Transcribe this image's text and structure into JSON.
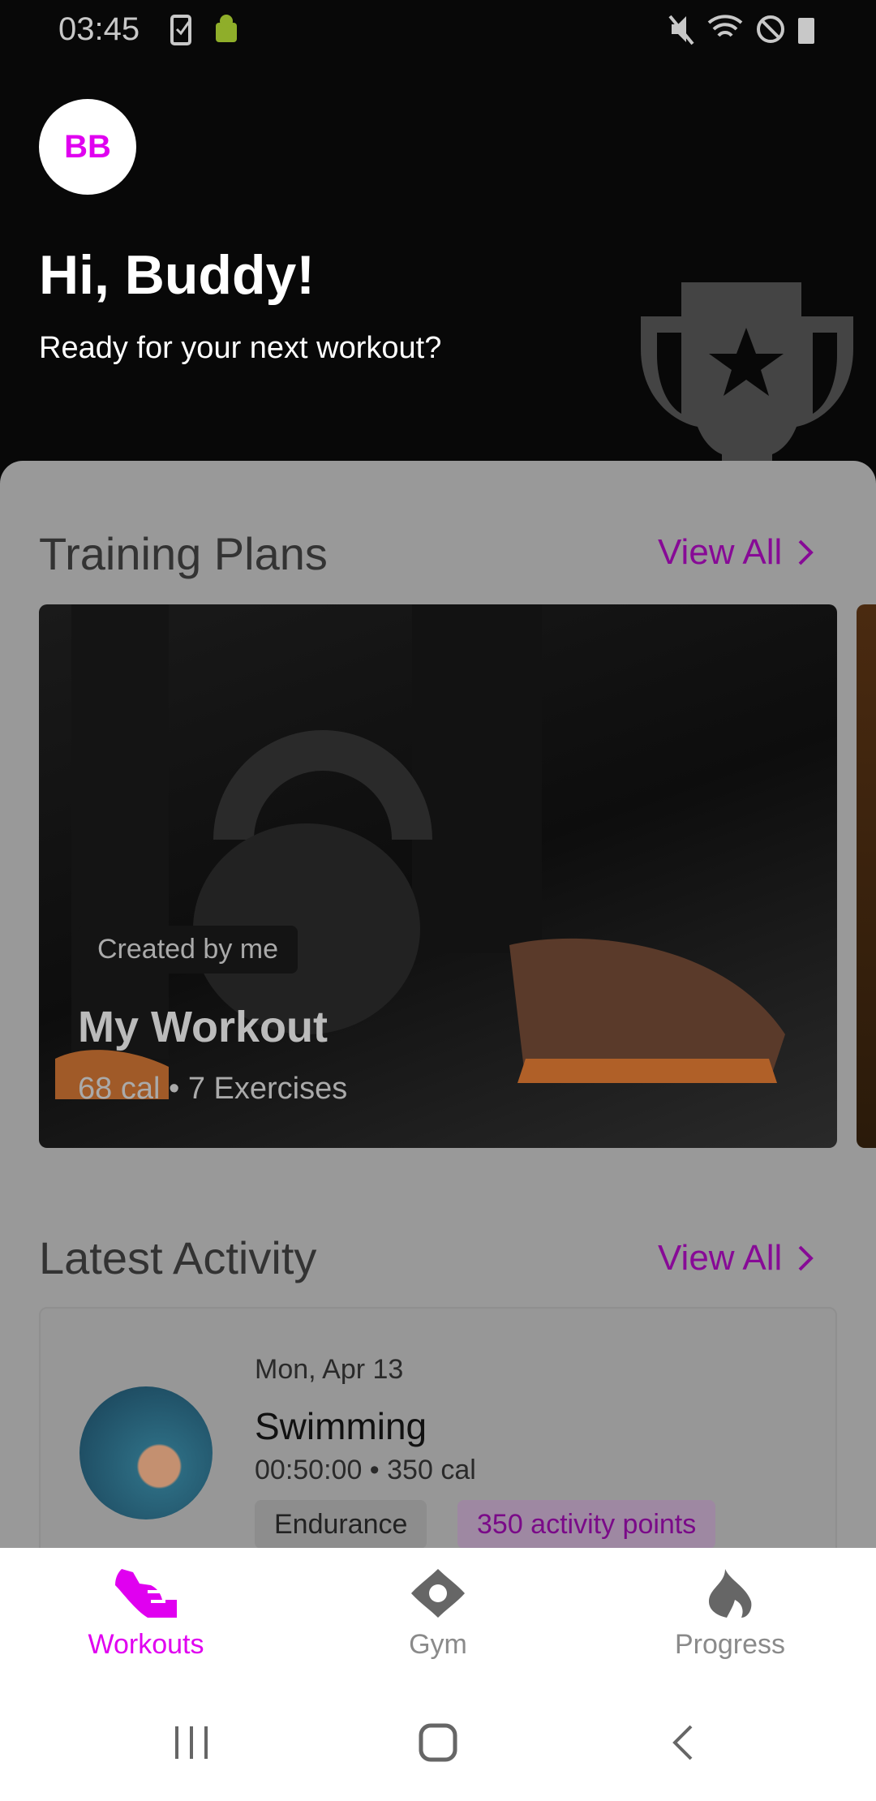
{
  "status_bar": {
    "time": "03:45",
    "icons": [
      "task-check-icon",
      "android-debug-icon",
      "mute-icon",
      "wifi-icon",
      "do-not-disturb-icon",
      "battery-icon"
    ]
  },
  "header": {
    "avatar_initials": "BB",
    "greeting": "Hi, Buddy!",
    "subtitle": "Ready for your next workout?",
    "decor_icon": "trophy-icon"
  },
  "training_plans": {
    "title": "Training Plans",
    "view_all": "View All",
    "cards": [
      {
        "badge": "Created by me",
        "title": "My Workout",
        "subtitle": "68 cal • 7 Exercises"
      }
    ]
  },
  "latest_activity": {
    "title": "Latest Activity",
    "view_all": "View All",
    "items": [
      {
        "date": "Mon, Apr 13",
        "title": "Swimming",
        "details": "00:50:00 • 350 cal",
        "tags": [
          "Endurance",
          "350 activity points"
        ]
      }
    ]
  },
  "bottom_nav": {
    "items": [
      {
        "label": "Workouts",
        "icon": "shoe-icon",
        "active": true
      },
      {
        "label": "Gym",
        "icon": "location-icon",
        "active": false
      },
      {
        "label": "Progress",
        "icon": "flame-icon",
        "active": false
      }
    ]
  },
  "colors": {
    "accent": "#e000f0",
    "accent_dim": "#870a96"
  }
}
